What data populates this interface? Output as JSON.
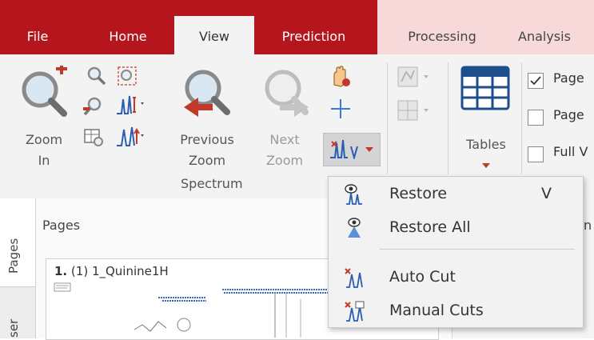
{
  "tabs": [
    {
      "label": "File"
    },
    {
      "label": "Home"
    },
    {
      "label": "View"
    },
    {
      "label": "Prediction"
    },
    {
      "label": "Processing"
    },
    {
      "label": "Analysis"
    }
  ],
  "ribbon": {
    "zoom_in": {
      "line1": "Zoom",
      "line2": "In"
    },
    "previous_zoom": {
      "line1": "Previous",
      "line2": "Zoom"
    },
    "next_zoom": {
      "line1": "Next",
      "line2": "Zoom"
    },
    "tables": {
      "label": "Tables"
    },
    "group_label": "Spectrum",
    "checkboxes": [
      {
        "label": "Page",
        "checked": true
      },
      {
        "label": "Page",
        "checked": false
      },
      {
        "label": "Full V",
        "checked": false
      }
    ]
  },
  "left": {
    "tab_pages": "Pages",
    "tab_user": "ser",
    "panel_title": "Pages",
    "thumb_num": "1.",
    "thumb_title": "(1) 1_Quinine1H"
  },
  "right_partial": {
    "text": "n"
  },
  "menu": {
    "items": [
      {
        "label": "Restore",
        "shortcut": "V",
        "icon": "restore-icon"
      },
      {
        "label": "Restore All",
        "shortcut": "",
        "icon": "restore-all-icon"
      },
      {
        "label": "Auto Cut",
        "shortcut": "",
        "icon": "auto-cut-icon"
      },
      {
        "label": "Manual Cuts",
        "shortcut": "",
        "icon": "manual-cuts-icon"
      }
    ]
  },
  "colors": {
    "accent_red": "#b5161d",
    "tab_pale": "#f7d9d9",
    "ribbon_bg": "#f3f3f3"
  }
}
